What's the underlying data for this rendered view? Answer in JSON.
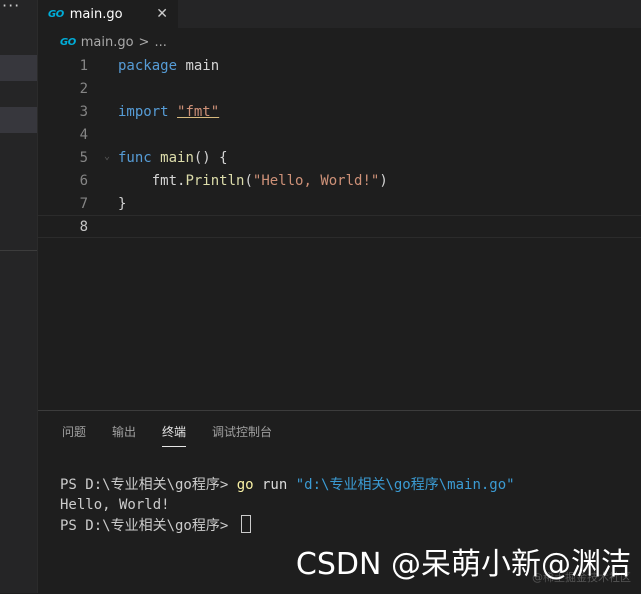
{
  "tab": {
    "icon": "go-icon",
    "logo_text": "GO",
    "filename": "main.go",
    "close": "✕"
  },
  "breadcrumb": {
    "logo_text": "GO",
    "filename": "main.go",
    "chevron": ">",
    "ellipsis": "..."
  },
  "editor": {
    "lines": [
      {
        "num": "1",
        "parts": [
          [
            "kw",
            "package"
          ],
          [
            "plain",
            " main"
          ]
        ]
      },
      {
        "num": "2",
        "parts": []
      },
      {
        "num": "3",
        "parts": [
          [
            "kw",
            "import"
          ],
          [
            "plain",
            " "
          ],
          [
            "str",
            "\"fmt\""
          ]
        ]
      },
      {
        "num": "4",
        "parts": []
      },
      {
        "num": "5",
        "parts": [
          [
            "kw",
            "func"
          ],
          [
            "plain",
            " "
          ],
          [
            "fn",
            "main"
          ],
          [
            "plain",
            "() {"
          ]
        ]
      },
      {
        "num": "6",
        "parts": [
          [
            "plain",
            "    fmt."
          ],
          [
            "fn",
            "Println"
          ],
          [
            "plain",
            "("
          ],
          [
            "str",
            "\"Hello, World!\""
          ],
          [
            "plain",
            ")"
          ]
        ]
      },
      {
        "num": "7",
        "parts": [
          [
            "plain",
            "}"
          ]
        ]
      },
      {
        "num": "8",
        "parts": []
      }
    ]
  },
  "panel": {
    "tabs": [
      "问题",
      "输出",
      "终端",
      "调试控制台"
    ],
    "active_tab": "终端"
  },
  "terminal": {
    "prompt1": "PS D:\\专业相关\\go程序> ",
    "cmd": "go",
    "run": " run ",
    "path": "\"d:\\专业相关\\go程序\\main.go\"",
    "output": "Hello, World!",
    "prompt2": "PS D:\\专业相关\\go程序> "
  },
  "watermark": {
    "csdn": "CSDN @呆萌小新@渊洁",
    "faint": "@稀土掘金技术社区"
  },
  "colors": {
    "keyword": "#569cd6",
    "string": "#ce9178",
    "function": "#dcdcaa",
    "go_blue": "#00add8"
  }
}
